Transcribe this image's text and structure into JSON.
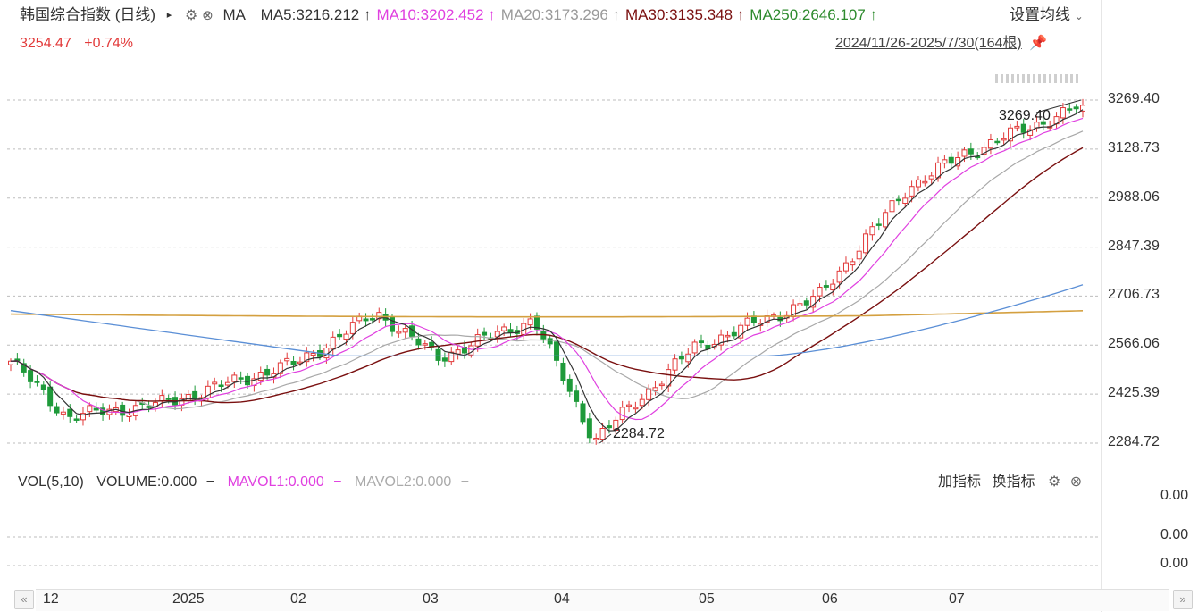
{
  "header": {
    "title": "韩国综合指数 (日线)",
    "ma_label": "MA",
    "ma_items": [
      {
        "text": "MA5:3216.212",
        "arrow": "↑",
        "color": "#333333"
      },
      {
        "text": "MA10:3202.452",
        "arrow": "↑",
        "color": "#e040e0"
      },
      {
        "text": "MA20:3173.296",
        "arrow": "↑",
        "color": "#9a9a9a"
      },
      {
        "text": "MA30:3135.348",
        "arrow": "↑",
        "color": "#7a1010"
      },
      {
        "text": "MA250:2646.107",
        "arrow": "↑",
        "color": "#2e8b2e"
      }
    ],
    "settings_label": "设置均线",
    "price": "3254.47",
    "change": "+0.74%",
    "date_range": "2024/11/26-2025/7/30(164根)"
  },
  "colors": {
    "up": "#e23a3a",
    "down": "#1f9a3a",
    "ma5": "#333333",
    "ma10": "#e040e0",
    "ma20": "#a8a8a8",
    "ma30": "#7a1010",
    "ma250": "#d4a040",
    "blue": "#5b8fd6"
  },
  "volume_panel": {
    "label": "VOL(5,10)",
    "volume": "VOLUME:0.000",
    "mavol1": "MAVOL1:0.000",
    "mavol2": "MAVOL2:0.000",
    "dash": "−",
    "add_indicator": "加指标",
    "switch_indicator": "换指标",
    "ticks": [
      "0.00",
      "0.00",
      "0.00"
    ]
  },
  "chart_data": {
    "type": "candlestick",
    "title": "韩国综合指数 (日线)",
    "y_ticks": [
      "3269.40",
      "3128.73",
      "2988.06",
      "2847.39",
      "2706.73",
      "2566.06",
      "2425.39",
      "2284.72"
    ],
    "ylim": [
      2284.72,
      3269.4
    ],
    "x_ticks": [
      "12",
      "2025",
      "02",
      "03",
      "04",
      "05",
      "06",
      "07"
    ],
    "annotations": [
      {
        "text": "3269.40",
        "value": 3269.4
      },
      {
        "text": "2284.72",
        "value": 2284.72
      }
    ],
    "key_points": [
      {
        "date": "2024-11-26",
        "close": 2520
      },
      {
        "date": "2024-12-09",
        "close": 2360
      },
      {
        "date": "2024-12-31",
        "close": 2399
      },
      {
        "date": "2025-01-31",
        "close": 2517
      },
      {
        "date": "2025-02-18",
        "close": 2660
      },
      {
        "date": "2025-03-04",
        "close": 2530
      },
      {
        "date": "2025-03-26",
        "close": 2640
      },
      {
        "date": "2025-04-09",
        "close": 2293
      },
      {
        "date": "2025-05-02",
        "close": 2560
      },
      {
        "date": "2025-05-30",
        "close": 2700
      },
      {
        "date": "2025-06-20",
        "close": 3020
      },
      {
        "date": "2025-07-03",
        "close": 3116
      },
      {
        "date": "2025-07-30",
        "close": 3254.47
      }
    ]
  }
}
